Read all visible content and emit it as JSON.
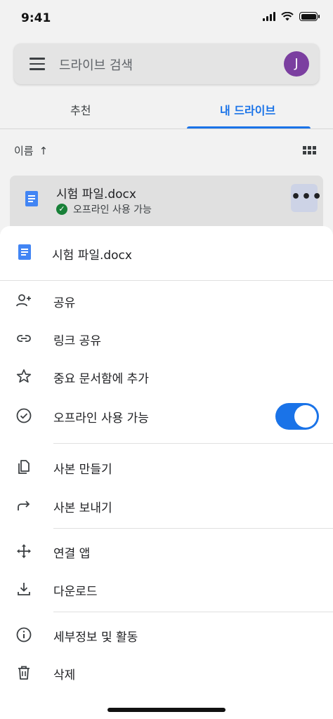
{
  "status_bar": {
    "time": "9:41"
  },
  "search": {
    "placeholder": "드라이브 검색",
    "avatar_letter": "J"
  },
  "tabs": [
    {
      "label": "추천"
    },
    {
      "label": "내 드라이브"
    }
  ],
  "sort": {
    "label": "이름",
    "arrow": "↑"
  },
  "file": {
    "name": "시험 파일.docx",
    "status": "오프라인 사용 가능",
    "more": "•••"
  },
  "sheet": {
    "file_name": "시험 파일.docx",
    "items": [
      {
        "label": "공유",
        "icon": "person-add-icon"
      },
      {
        "label": "링크 공유",
        "icon": "link-icon"
      },
      {
        "label": "중요 문서함에 추가",
        "icon": "star-icon"
      },
      {
        "label": "오프라인 사용 가능",
        "icon": "offline-check-icon",
        "toggle": true
      },
      {
        "label": "사본 만들기",
        "icon": "copy-icon"
      },
      {
        "label": "사본 보내기",
        "icon": "send-arrow-icon"
      },
      {
        "label": "연결 앱",
        "icon": "move-arrows-icon"
      },
      {
        "label": "다운로드",
        "icon": "download-icon"
      },
      {
        "label": "세부정보 및 활동",
        "icon": "info-icon"
      },
      {
        "label": "삭제",
        "icon": "trash-icon"
      }
    ]
  },
  "colors": {
    "accent": "#1a73e8",
    "doc_blue": "#4285f4",
    "avatar": "#7b3fa0",
    "offline_green": "#188038"
  }
}
